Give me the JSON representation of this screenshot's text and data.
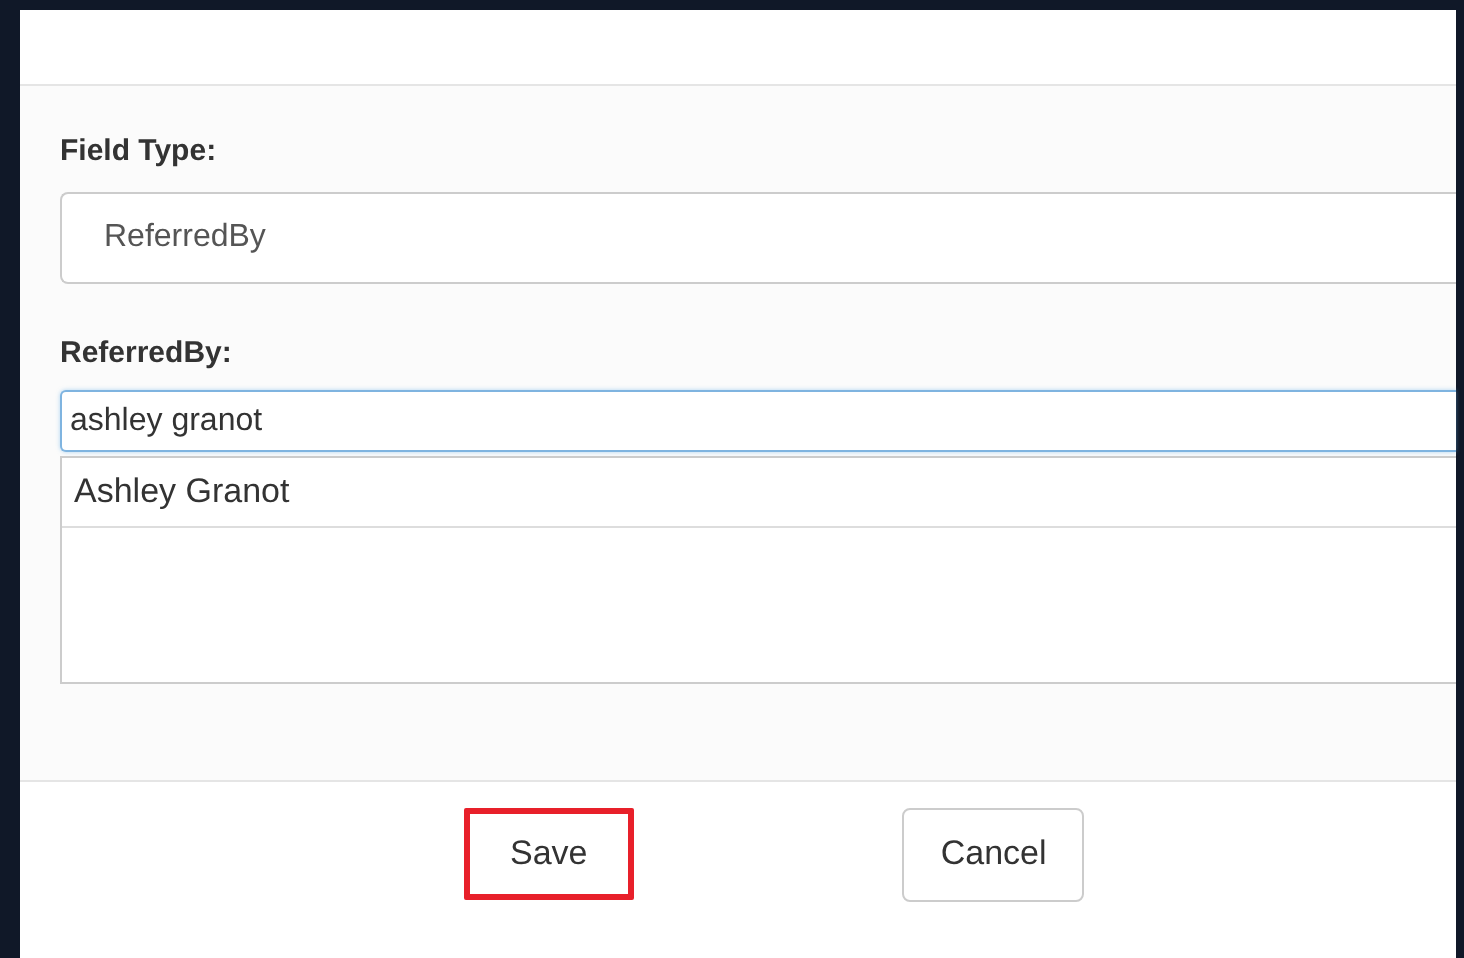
{
  "form": {
    "field_type": {
      "label": "Field Type:",
      "value": "ReferredBy"
    },
    "referred_by": {
      "label": "ReferredBy:",
      "value": "ashley granot",
      "suggestions": [
        {
          "label": "Ashley Granot",
          "selected": false
        }
      ]
    }
  },
  "buttons": [
    {
      "label": "Save",
      "highlighted": true
    },
    {
      "label": "Cancel",
      "highlighted": false
    }
  ]
}
